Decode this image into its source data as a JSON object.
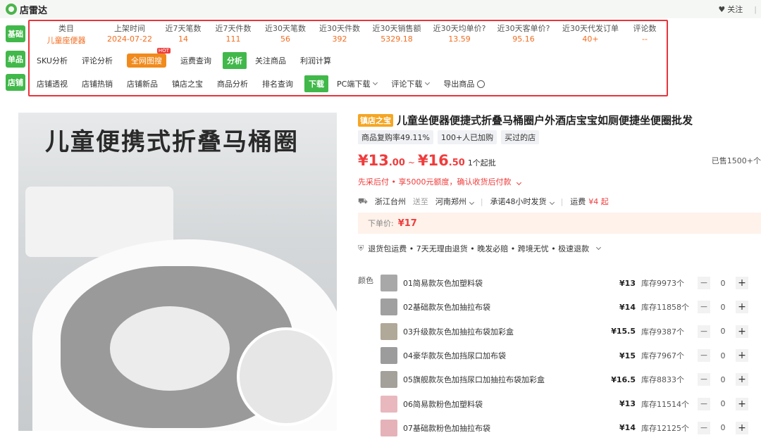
{
  "app": {
    "name": "店雷达"
  },
  "top_actions": {
    "follow": "关注",
    "divider": "|"
  },
  "left_tags": [
    "基础",
    "单品",
    "店铺"
  ],
  "stats": {
    "headers": [
      "类目",
      "上架时间",
      "近7天笔数",
      "近7天件数",
      "近30天笔数",
      "近30天件数",
      "近30天销售额",
      "近30天均单价?",
      "近30天客单价?",
      "近30天代发订单",
      "评论数"
    ],
    "values": [
      "儿童座便器",
      "2024-07-22",
      "14",
      "111",
      "56",
      "392",
      "5329.18",
      "13.59",
      "95.16",
      "40+",
      "--"
    ]
  },
  "row2": {
    "items": [
      "SKU分析",
      "评论分析",
      "全网图搜",
      "运费查询"
    ],
    "hot": "HOT",
    "group_label": "分析",
    "group_items": [
      "关注商品",
      "利润计算"
    ]
  },
  "row3": {
    "items": [
      "店铺透视",
      "店铺热销",
      "店铺新品",
      "镇店之宝",
      "商品分析",
      "排名查询"
    ],
    "group_label": "下载",
    "group_items": [
      "PC端下载",
      "评论下载",
      "导出商品"
    ]
  },
  "image": {
    "title": "儿童便携式折叠马桶圈"
  },
  "product": {
    "tag": "镇店之宝",
    "title": "儿童坐便器便捷式折叠马桶圈户外酒店宝宝如厕便捷坐便圈批发",
    "badges": [
      "商品复购率49.11%",
      "100+人已加购",
      "买过的店"
    ],
    "price_low_int": "¥13",
    "price_low_dec": ".00",
    "tilde": "~",
    "price_high_int": "¥16",
    "price_high_dec": ".50",
    "moq": "1个起批",
    "sold": "已售1500+个",
    "pay_later": "先采后付 • 享5000元额度，确认收货后付款",
    "origin": "浙江台州",
    "ship_to_label": "送至",
    "ship_to": "河南郑州",
    "dispatch": "承诺48小时发货",
    "freight_label": "运费",
    "freight": "¥4 起",
    "order_label": "下单价:",
    "order_price": "¥17",
    "services": "退货包运费 • 7天无理由退货 • 晚发必赔 • 跨境无忧 • 极速退款",
    "color_label": "颜色"
  },
  "variants": [
    {
      "name": "01简易款灰色加塑料袋",
      "price": "¥13",
      "stock": "库存9973个",
      "qty": "0",
      "color": "#a8a8a8"
    },
    {
      "name": "02基础款灰色加抽拉布袋",
      "price": "¥14",
      "stock": "库存11858个",
      "qty": "0",
      "color": "#a0a0a0"
    },
    {
      "name": "03升级款灰色加抽拉布袋加彩盒",
      "price": "¥15.5",
      "stock": "库存9387个",
      "qty": "0",
      "color": "#b0a898"
    },
    {
      "name": "04豪华款灰色加挡尿口加布袋",
      "price": "¥15",
      "stock": "库存7967个",
      "qty": "0",
      "color": "#9c9c9c"
    },
    {
      "name": "05旗舰款灰色加挡尿口加抽拉布袋加彩盒",
      "price": "¥16.5",
      "stock": "库存8833个",
      "qty": "0",
      "color": "#a4a09a"
    },
    {
      "name": "06简易款粉色加塑料袋",
      "price": "¥13",
      "stock": "库存11514个",
      "qty": "0",
      "color": "#e8b8be"
    },
    {
      "name": "07基础款粉色加抽拉布袋",
      "price": "¥14",
      "stock": "库存12125个",
      "qty": "0",
      "color": "#e4b2b8"
    }
  ],
  "stepper": {
    "minus": "−",
    "plus": "+"
  }
}
